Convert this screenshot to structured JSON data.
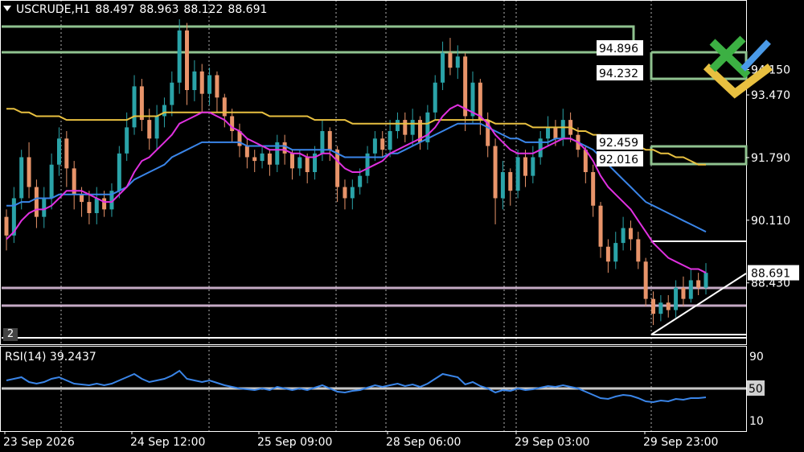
{
  "header": {
    "symbol": "USCRUDE,H1",
    "open": "88.497",
    "high": "88.963",
    "low": "88.122",
    "close": "88.691"
  },
  "rsi": {
    "label": "RSI(14) 39.2437",
    "levels": [
      "90",
      "50",
      "10"
    ]
  },
  "window_index": "2",
  "colors": {
    "bull": "#2aa3a8",
    "bear": "#e8946a",
    "ma_fast": "#e030e0",
    "ma_mid": "#3a85e8",
    "ma_slow": "#e8c040",
    "grid": "#ffffff",
    "box": "#8fc28f",
    "rsi": "#3a85e8"
  },
  "chart_data": {
    "type": "candlestick",
    "price_labels": [
      "94.150",
      "93.470",
      "91.790",
      "90.110",
      "88.430"
    ],
    "time_labels": [
      "23 Sep 2026",
      "24 Sep 12:00",
      "25 Sep 09:00",
      "28 Sep 06:00",
      "29 Sep 03:00",
      "29 Sep 23:00"
    ],
    "current_price": "88.691",
    "level_tags": [
      "94.896",
      "94.232",
      "92.459",
      "92.016"
    ],
    "ylim": [
      87.0,
      95.8
    ],
    "candles": [
      [
        90.2,
        89.7,
        90.4,
        89.3
      ],
      [
        89.7,
        90.7,
        91.0,
        89.5
      ],
      [
        90.7,
        91.8,
        92.0,
        90.4
      ],
      [
        91.8,
        91.0,
        92.2,
        90.7
      ],
      [
        91.0,
        90.2,
        91.2,
        89.9
      ],
      [
        90.2,
        90.7,
        91.0,
        89.9
      ],
      [
        90.7,
        91.6,
        91.9,
        90.4
      ],
      [
        91.6,
        92.3,
        92.6,
        91.3
      ],
      [
        92.3,
        91.5,
        92.5,
        91.0
      ],
      [
        91.5,
        90.8,
        91.7,
        90.4
      ],
      [
        90.8,
        90.6,
        91.0,
        90.2
      ],
      [
        90.6,
        90.3,
        90.9,
        90.0
      ],
      [
        90.3,
        90.7,
        91.0,
        90.0
      ],
      [
        90.7,
        90.4,
        90.9,
        90.2
      ],
      [
        90.4,
        90.9,
        91.1,
        90.2
      ],
      [
        90.9,
        91.9,
        92.1,
        90.7
      ],
      [
        91.9,
        92.6,
        93.0,
        91.7
      ],
      [
        92.6,
        93.7,
        94.0,
        92.4
      ],
      [
        93.7,
        92.8,
        93.9,
        92.5
      ],
      [
        92.8,
        92.3,
        93.1,
        92.0
      ],
      [
        92.3,
        92.9,
        93.2,
        92.0
      ],
      [
        92.9,
        93.2,
        93.4,
        92.6
      ],
      [
        93.2,
        93.8,
        94.1,
        92.9
      ],
      [
        93.8,
        95.2,
        95.5,
        93.5
      ],
      [
        95.2,
        93.6,
        95.4,
        93.2
      ],
      [
        93.6,
        94.1,
        94.4,
        93.3
      ],
      [
        94.1,
        93.5,
        94.3,
        93.0
      ],
      [
        93.5,
        94.0,
        94.2,
        93.2
      ],
      [
        94.0,
        93.4,
        94.1,
        93.0
      ],
      [
        93.4,
        92.9,
        93.5,
        92.6
      ],
      [
        92.9,
        92.5,
        93.1,
        92.2
      ],
      [
        92.5,
        92.1,
        92.7,
        91.8
      ],
      [
        92.1,
        91.8,
        92.3,
        91.5
      ],
      [
        91.8,
        91.7,
        92.0,
        91.4
      ],
      [
        91.7,
        91.9,
        92.1,
        91.5
      ],
      [
        91.9,
        91.6,
        92.0,
        91.3
      ],
      [
        91.6,
        92.2,
        92.4,
        91.4
      ],
      [
        92.2,
        91.9,
        92.4,
        91.6
      ],
      [
        91.9,
        91.5,
        92.0,
        91.2
      ],
      [
        91.5,
        91.8,
        92.0,
        91.3
      ],
      [
        91.8,
        91.4,
        91.9,
        91.1
      ],
      [
        91.4,
        91.9,
        92.1,
        91.2
      ],
      [
        91.9,
        92.5,
        92.8,
        91.7
      ],
      [
        92.5,
        92.0,
        92.6,
        91.7
      ],
      [
        92.0,
        91.0,
        92.1,
        90.6
      ],
      [
        91.0,
        90.7,
        91.2,
        90.4
      ],
      [
        90.7,
        91.0,
        91.2,
        90.4
      ],
      [
        91.0,
        91.3,
        91.5,
        90.8
      ],
      [
        91.3,
        91.9,
        92.1,
        91.1
      ],
      [
        91.9,
        92.3,
        92.5,
        91.7
      ],
      [
        92.3,
        92.0,
        92.5,
        91.8
      ],
      [
        92.0,
        92.5,
        92.8,
        91.8
      ],
      [
        92.5,
        92.8,
        93.0,
        92.3
      ],
      [
        92.8,
        92.4,
        93.0,
        92.2
      ],
      [
        92.4,
        92.8,
        93.1,
        92.1
      ],
      [
        92.8,
        92.2,
        92.9,
        92.0
      ],
      [
        92.2,
        93.0,
        93.2,
        92.0
      ],
      [
        93.0,
        93.8,
        94.0,
        92.8
      ],
      [
        93.8,
        94.6,
        94.9,
        93.6
      ],
      [
        94.6,
        94.2,
        95.0,
        94.0
      ],
      [
        94.2,
        94.5,
        94.8,
        93.9
      ],
      [
        94.5,
        92.9,
        94.6,
        92.5
      ],
      [
        92.9,
        93.8,
        94.1,
        92.7
      ],
      [
        93.8,
        92.8,
        93.9,
        92.4
      ],
      [
        92.8,
        92.1,
        93.0,
        91.8
      ],
      [
        92.1,
        90.7,
        92.3,
        90.0
      ],
      [
        90.7,
        91.4,
        91.7,
        90.4
      ],
      [
        91.4,
        90.9,
        91.5,
        90.5
      ],
      [
        90.9,
        91.8,
        92.0,
        90.7
      ],
      [
        91.8,
        91.3,
        92.0,
        91.0
      ],
      [
        91.3,
        91.8,
        92.1,
        91.1
      ],
      [
        91.8,
        92.3,
        92.5,
        91.6
      ],
      [
        92.3,
        92.6,
        92.9,
        92.1
      ],
      [
        92.6,
        92.3,
        92.8,
        92.1
      ],
      [
        92.3,
        92.8,
        93.1,
        92.1
      ],
      [
        92.8,
        92.4,
        93.0,
        92.2
      ],
      [
        92.4,
        92.0,
        92.6,
        91.8
      ],
      [
        92.0,
        91.4,
        92.1,
        91.1
      ],
      [
        91.4,
        90.5,
        91.6,
        90.2
      ],
      [
        90.5,
        89.4,
        90.6,
        89.1
      ],
      [
        89.4,
        89.0,
        89.6,
        88.7
      ],
      [
        89.0,
        89.5,
        89.8,
        88.8
      ],
      [
        89.5,
        89.9,
        90.2,
        89.3
      ],
      [
        89.9,
        89.6,
        90.1,
        89.3
      ],
      [
        89.6,
        89.0,
        89.8,
        88.8
      ],
      [
        89.0,
        88.0,
        89.1,
        87.8
      ],
      [
        88.0,
        87.6,
        88.2,
        87.3
      ],
      [
        87.6,
        87.9,
        88.1,
        87.4
      ],
      [
        87.9,
        87.7,
        88.1,
        87.5
      ],
      [
        87.7,
        88.3,
        88.5,
        87.5
      ],
      [
        88.3,
        88.0,
        88.6,
        87.8
      ],
      [
        88.0,
        88.5,
        88.8,
        87.9
      ],
      [
        88.5,
        88.3,
        88.7,
        88.1
      ],
      [
        88.3,
        88.7,
        88.96,
        88.12
      ]
    ],
    "ma_fast": [
      89.6,
      89.8,
      90.1,
      90.3,
      90.4,
      90.4,
      90.5,
      90.7,
      90.9,
      90.9,
      90.9,
      90.8,
      90.7,
      90.6,
      90.6,
      90.8,
      91.0,
      91.4,
      91.7,
      91.8,
      92.0,
      92.2,
      92.4,
      92.7,
      92.8,
      92.9,
      93.0,
      93.0,
      92.9,
      92.8,
      92.6,
      92.5,
      92.3,
      92.2,
      92.1,
      92.0,
      92.0,
      92.0,
      91.9,
      91.9,
      91.8,
      91.8,
      91.9,
      91.9,
      91.7,
      91.5,
      91.4,
      91.4,
      91.5,
      91.6,
      91.7,
      91.9,
      92.0,
      92.1,
      92.2,
      92.3,
      92.4,
      92.6,
      92.9,
      93.1,
      93.2,
      93.1,
      93.0,
      92.9,
      92.7,
      92.4,
      92.2,
      92.0,
      91.9,
      91.9,
      91.9,
      92.0,
      92.1,
      92.2,
      92.3,
      92.3,
      92.2,
      92.0,
      91.7,
      91.3,
      91.0,
      90.8,
      90.6,
      90.4,
      90.1,
      89.8,
      89.5,
      89.3,
      89.1,
      89.0,
      88.9,
      88.8,
      88.8,
      88.7
    ],
    "ma_mid": [
      90.5,
      90.5,
      90.6,
      90.6,
      90.7,
      90.7,
      90.7,
      90.8,
      90.8,
      90.8,
      90.8,
      90.8,
      90.8,
      90.8,
      90.8,
      90.9,
      91.0,
      91.2,
      91.3,
      91.4,
      91.5,
      91.6,
      91.8,
      91.9,
      92.0,
      92.1,
      92.2,
      92.2,
      92.2,
      92.2,
      92.2,
      92.2,
      92.1,
      92.1,
      92.1,
      92.1,
      92.1,
      92.1,
      92.0,
      92.0,
      92.0,
      92.0,
      92.0,
      92.0,
      91.9,
      91.8,
      91.8,
      91.8,
      91.8,
      91.8,
      91.8,
      91.9,
      91.9,
      92.0,
      92.1,
      92.2,
      92.3,
      92.4,
      92.5,
      92.6,
      92.7,
      92.7,
      92.7,
      92.7,
      92.6,
      92.5,
      92.4,
      92.3,
      92.3,
      92.2,
      92.2,
      92.2,
      92.2,
      92.3,
      92.3,
      92.3,
      92.2,
      92.1,
      92.0,
      91.8,
      91.6,
      91.4,
      91.2,
      91.0,
      90.8,
      90.6,
      90.5,
      90.4,
      90.3,
      90.2,
      90.1,
      90.0,
      89.9,
      89.8
    ],
    "ma_slow": [
      93.1,
      93.1,
      93.0,
      93.0,
      92.9,
      92.9,
      92.9,
      92.9,
      92.8,
      92.8,
      92.8,
      92.8,
      92.8,
      92.8,
      92.8,
      92.8,
      92.8,
      92.9,
      92.9,
      92.9,
      92.9,
      93.0,
      93.0,
      93.0,
      93.0,
      93.0,
      93.0,
      93.0,
      93.0,
      93.0,
      93.0,
      93.0,
      93.0,
      93.0,
      93.0,
      92.9,
      92.9,
      92.9,
      92.9,
      92.9,
      92.9,
      92.8,
      92.8,
      92.8,
      92.8,
      92.8,
      92.7,
      92.7,
      92.7,
      92.7,
      92.7,
      92.7,
      92.7,
      92.7,
      92.7,
      92.7,
      92.7,
      92.8,
      92.8,
      92.8,
      92.8,
      92.8,
      92.8,
      92.8,
      92.8,
      92.7,
      92.7,
      92.7,
      92.7,
      92.7,
      92.6,
      92.6,
      92.6,
      92.6,
      92.6,
      92.6,
      92.5,
      92.5,
      92.4,
      92.4,
      92.3,
      92.3,
      92.2,
      92.2,
      92.1,
      92.0,
      92.0,
      91.9,
      91.9,
      91.8,
      91.8,
      91.7,
      91.6,
      91.6
    ],
    "rsi": [
      60,
      62,
      64,
      58,
      56,
      58,
      62,
      64,
      60,
      56,
      55,
      54,
      56,
      54,
      56,
      60,
      64,
      68,
      62,
      58,
      60,
      62,
      66,
      72,
      62,
      60,
      58,
      60,
      57,
      54,
      52,
      50,
      49,
      48,
      50,
      48,
      52,
      50,
      48,
      50,
      48,
      51,
      54,
      50,
      46,
      45,
      47,
      48,
      51,
      54,
      52,
      54,
      56,
      53,
      55,
      52,
      56,
      62,
      68,
      66,
      64,
      55,
      58,
      53,
      50,
      45,
      48,
      47,
      50,
      48,
      49,
      51,
      53,
      52,
      54,
      52,
      50,
      46,
      42,
      38,
      37,
      40,
      42,
      41,
      38,
      34,
      33,
      35,
      34,
      37,
      36,
      38,
      38,
      39
    ]
  }
}
